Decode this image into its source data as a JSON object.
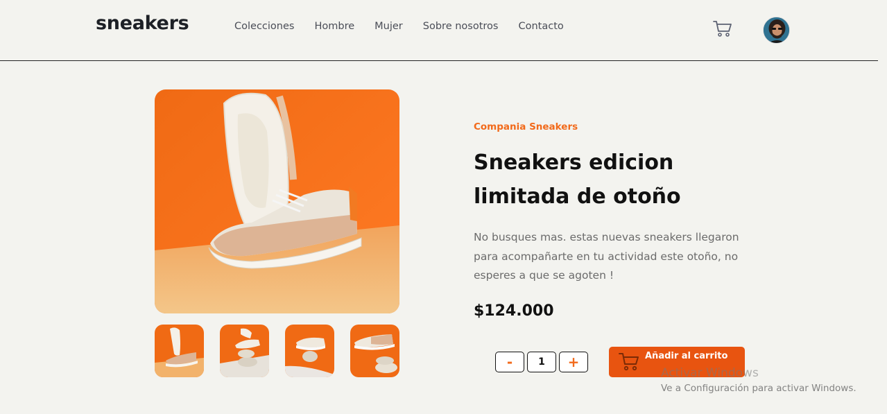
{
  "header": {
    "logo": "sneakers",
    "nav": [
      "Colecciones",
      "Hombre",
      "Mujer",
      "Sobre nosotros",
      "Contacto"
    ],
    "cart_icon": "cart-icon",
    "avatar_icon": "user-avatar"
  },
  "product": {
    "company": "Compania Sneakers",
    "title": "Sneakers edicion limitada de otoño",
    "description": "No busques mas. estas nuevas sneakers llegaron para acompañarte en tu actividad este otoño, no esperes a que se agoten !",
    "price": "$124.000",
    "quantity": "1",
    "minus_label": "-",
    "plus_label": "+",
    "add_to_cart_label": "Añadir al carrito"
  },
  "watermark": {
    "title": "Activar Windows",
    "subtitle": "Ve a Configuración para activar Windows."
  },
  "colors": {
    "accent": "#f26a1b",
    "button": "#e85410",
    "background": "#f3f3ef"
  }
}
